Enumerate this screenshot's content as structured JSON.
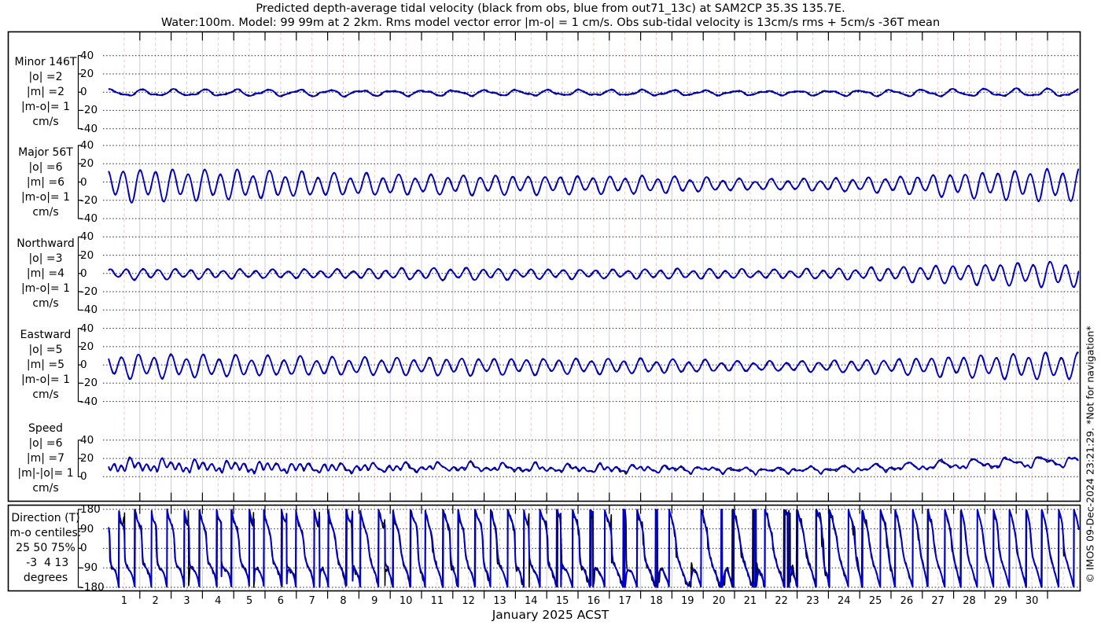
{
  "title": {
    "line1": "Predicted depth-average tidal velocity (black from obs, blue from out71_13c) at SAM2CP 35.3S 135.7E.",
    "line2": "Water:100m. Model: 99 99m at 2 2km. Rms model vector error |m-o| = 1 cm/s. Obs sub-tidal velocity is 13cm/s rms + 5cm/s -36T mean"
  },
  "watermark": "© IMOS 09-Dec-2024 23:21:29. *Not for navigation*",
  "x_axis": {
    "label": "January 2025 ACST",
    "day_labels": [
      "1",
      "2",
      "3",
      "4",
      "5",
      "6",
      "7",
      "8",
      "9",
      "10",
      "11",
      "12",
      "13",
      "14",
      "15",
      "16",
      "17",
      "18",
      "19",
      "20",
      "21",
      "22",
      "23",
      "24",
      "25",
      "26",
      "27",
      "28",
      "29",
      "30"
    ],
    "days_total": 31
  },
  "chart_data": {
    "type": "line",
    "title": "Predicted depth-average tidal velocity at SAM2CP",
    "x": {
      "axis_label": "January 2025 ACST",
      "start_day": 0,
      "end_day": 31
    },
    "period_semidiurnal_hours": 12.42,
    "period_diurnal_hours": 23.93,
    "colors": {
      "model": "#0000cc",
      "obs": "#000000",
      "grid_day": "#ccccdd",
      "grid_halfday": "#eec9c9",
      "grid_dotted": "#222222"
    },
    "legend": [
      {
        "name": "obs",
        "color": "#000000"
      },
      {
        "name": "model out71_13c",
        "color": "#0000cc"
      }
    ],
    "panels": [
      {
        "id": "minor",
        "label_lines": [
          "Minor 146T",
          "|o| =2",
          "|m| =2",
          "|m-o|= 1",
          "cm/s"
        ],
        "yticks": [
          40,
          20,
          0,
          -20,
          -40
        ],
        "units": "cm/s",
        "synth": {
          "kind": "velocity",
          "mean": -0.8,
          "w_semi": 0.35,
          "w_diur": 1.0,
          "ph_semi": 1.4,
          "ph_diur": 1.0,
          "amp_by_day": [
            3,
            3,
            3,
            3,
            3,
            3,
            3,
            3,
            2.6,
            2.6,
            2.6,
            2.6,
            2.6,
            2.6,
            2.6,
            2.6,
            2.6,
            2.6,
            2.4,
            2.2,
            2,
            2,
            2.2,
            2.5,
            2.8,
            3,
            3.2,
            3.4,
            3.6,
            3.6,
            3.6
          ]
        }
      },
      {
        "id": "major",
        "label_lines": [
          "Major 56T",
          "|o| =6",
          "|m| =6",
          "|m-o|= 1",
          "cm/s"
        ],
        "yticks": [
          40,
          20,
          0,
          -20,
          -40
        ],
        "units": "cm/s",
        "synth": {
          "kind": "velocity",
          "mean": -3,
          "w_semi": 1.0,
          "w_diur": 0.3,
          "ph_semi": 2.0,
          "ph_diur": 0.2,
          "amp_by_day": [
            15,
            15,
            14,
            14,
            13,
            12,
            11,
            10,
            10,
            9,
            9,
            9,
            9,
            8.5,
            8.5,
            8,
            8,
            8,
            7,
            6,
            5,
            5,
            5.5,
            6,
            7,
            8,
            10,
            11.5,
            13,
            14,
            15
          ]
        }
      },
      {
        "id": "northward",
        "label_lines": [
          "Northward",
          "|o| =3",
          "|m| =4",
          "|m-o|= 1",
          "cm/s"
        ],
        "yticks": [
          40,
          20,
          0,
          -20,
          -40
        ],
        "units": "cm/s",
        "synth": {
          "kind": "velocity",
          "mean": -0.5,
          "w_semi": 1.0,
          "w_diur": 0.3,
          "ph_semi": 0.9,
          "ph_diur": -0.4,
          "amp_by_day": [
            5,
            5,
            4.5,
            4.5,
            4,
            4,
            4,
            4,
            4.5,
            5,
            5.5,
            5.5,
            5,
            4.5,
            4.5,
            4,
            4,
            4.5,
            4.5,
            4.5,
            4,
            4,
            4.5,
            5,
            6,
            7,
            8,
            9,
            10,
            11,
            12
          ]
        }
      },
      {
        "id": "eastward",
        "label_lines": [
          "Eastward",
          "|o| =5",
          "|m| =5",
          "|m-o|= 1",
          "cm/s"
        ],
        "yticks": [
          40,
          20,
          0,
          -20,
          -40
        ],
        "units": "cm/s",
        "synth": {
          "kind": "velocity",
          "mean": -1.5,
          "w_semi": 1.0,
          "w_diur": 0.3,
          "ph_semi": 2.6,
          "ph_diur": 0.8,
          "amp_by_day": [
            11,
            11,
            10.5,
            10,
            9.5,
            9,
            8.5,
            8,
            8,
            8,
            8,
            8,
            7.5,
            7.5,
            7,
            7,
            7,
            6.5,
            6,
            5,
            4.5,
            4.5,
            5,
            5.5,
            6.5,
            7.5,
            9,
            10,
            11,
            12,
            12
          ]
        }
      },
      {
        "id": "speed",
        "label_lines": [
          "Speed",
          "|o| =6",
          "|m| =7",
          "|m|-|o|= 1",
          "cm/s"
        ],
        "yticks": [
          40,
          20,
          0
        ],
        "units": "cm/s",
        "synth": {
          "kind": "speed",
          "scale": 1.25,
          "offset": 1.4
        }
      },
      {
        "id": "direction",
        "label_lines": [
          "Direction (T)",
          "m-o centiles:",
          "25 50 75%",
          " -3  4 13",
          "degrees"
        ],
        "yticks": [
          180,
          90,
          0,
          -90,
          -180
        ],
        "units": "degrees",
        "synth": {
          "kind": "direction",
          "mean_east": -2.2,
          "mean_north": -2.8
        }
      }
    ]
  }
}
